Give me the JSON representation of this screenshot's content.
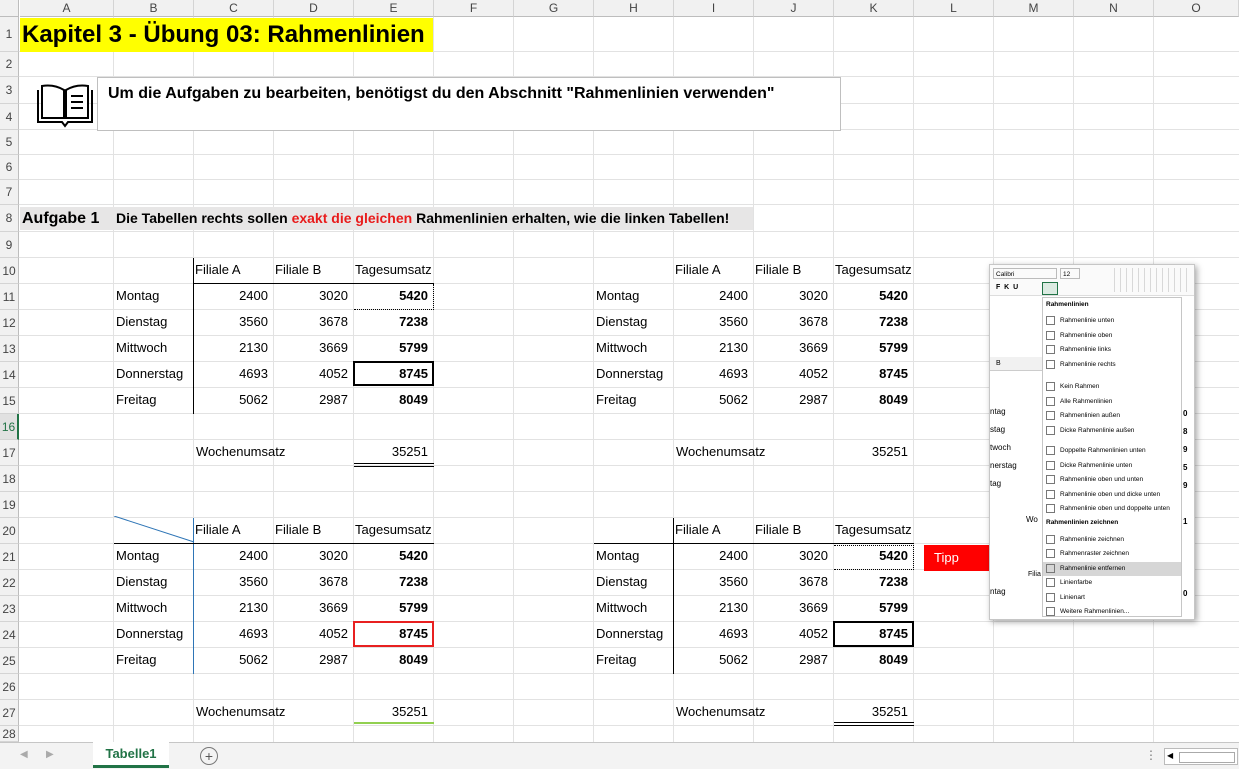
{
  "columns": [
    "A",
    "B",
    "C",
    "D",
    "E",
    "F",
    "G",
    "H",
    "I",
    "J",
    "K",
    "L",
    "M",
    "N",
    "O"
  ],
  "rows": [
    "1",
    "2",
    "3",
    "4",
    "5",
    "6",
    "7",
    "8",
    "9",
    "10",
    "11",
    "12",
    "13",
    "14",
    "15",
    "16",
    "17",
    "18",
    "19",
    "20",
    "21",
    "22",
    "23",
    "24",
    "25",
    "26",
    "27",
    "28"
  ],
  "selected_row": "16",
  "title": "Kapitel 3 - Übung 03: Rahmenlinien",
  "info": "Um die Aufgaben zu bearbeiten, benötigst du den Abschnitt \"Rahmenlinien verwenden\"",
  "task": {
    "label": "Aufgabe 1",
    "text_before": "Die Tabellen rechts sollen ",
    "text_highlight": "exakt die gleichen",
    "text_after": " Rahmenlinien erhalten, wie die linken Tabellen!"
  },
  "table": {
    "headers": [
      "Filiale A",
      "Filiale B",
      "Tagesumsatz"
    ],
    "rows": [
      {
        "day": "Montag",
        "a": "2400",
        "b": "3020",
        "total": "5420"
      },
      {
        "day": "Dienstag",
        "a": "3560",
        "b": "3678",
        "total": "7238"
      },
      {
        "day": "Mittwoch",
        "a": "2130",
        "b": "3669",
        "total": "5799"
      },
      {
        "day": "Donnerstag",
        "a": "4693",
        "b": "4052",
        "total": "8745"
      },
      {
        "day": "Freitag",
        "a": "5062",
        "b": "2987",
        "total": "8049"
      }
    ],
    "week_label": "Wochenumsatz",
    "week_total": "35251"
  },
  "sheet_tab": "Tabelle1",
  "tipp": "Tipp",
  "popup": {
    "font": "Calibri",
    "size": "12",
    "hdr_col": "B",
    "section1": "Rahmenlinien",
    "group1": [
      "Rahmenlinie unten",
      "Rahmenlinie oben",
      "Rahmenlinie links",
      "Rahmenlinie rechts"
    ],
    "group2": [
      "Kein Rahmen",
      "Alle Rahmenlinien",
      "Rahmenlinien außen",
      "Dicke Rahmenlinie außen"
    ],
    "group3": [
      "Doppelte Rahmenlinien unten",
      "Dicke Rahmenlinie unten",
      "Rahmenlinie oben und unten",
      "Rahmenlinie oben und dicke unten",
      "Rahmenlinie oben und doppelte unten"
    ],
    "section2": "Rahmenlinien zeichnen",
    "group4": [
      "Rahmenlinie zeichnen",
      "Rahmenraster zeichnen",
      "Rahmenlinie entfernen",
      "Linienfarbe",
      "Linienart",
      "Weitere Rahmenlinien..."
    ],
    "bg_rows": [
      "ntag",
      "stag",
      "twoch",
      "nerstag",
      "tag",
      "ntag"
    ],
    "bg_right": [
      "0",
      "8",
      "9",
      "5",
      "9",
      "1",
      "0"
    ],
    "bg_header": "Filia",
    "bg_wo": "Wo"
  }
}
